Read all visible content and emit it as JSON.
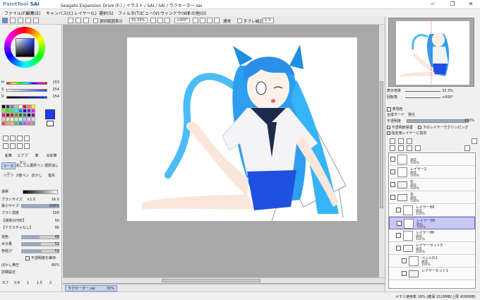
{
  "titlebar": {
    "app_name_prefix": "PaintTool",
    "app_name": "SAI",
    "title": "Seagate Expansion Drive (F:) / イラスト / SAI / SAI / ラクセーター.sai",
    "minimize": "─",
    "maximize": "❐",
    "close": "✕"
  },
  "menu": [
    "ファイル(F)",
    "編集(E)",
    "キャンバス(C)",
    "レイヤー(L)",
    "選択(S)",
    "フィルタ(T)",
    "ビュー(V)",
    "ウィンドウ(W)",
    "その他(O)"
  ],
  "toolbar": {
    "selection_label": "選択範囲表示",
    "zoom": "33.33%",
    "rotation": "+000°",
    "blend_label": "通常",
    "stabilizer_label": "手ブレ補正",
    "stabilizer_value": "S-3"
  },
  "color": {
    "current": "#1a3cff",
    "secondary": "#ffffff",
    "h_label": "H",
    "h_value": "153",
    "s_label": "S",
    "s_value": "254",
    "v_label": "V",
    "v_value": "254",
    "swatches": [
      "#000000",
      "#404040",
      "#808080",
      "#c0c0c0",
      "#ffffff",
      "#ff0000",
      "#ff8000",
      "#ffff00",
      "#80ff00",
      "#00ff00",
      "#00ff80",
      "#00ffff",
      "#0080ff",
      "#0000ff",
      "#8000ff",
      "#ff00ff",
      "#ff0080",
      "#800000",
      "#804000",
      "#808000",
      "#008000",
      "#008080",
      "#000080",
      "#800080",
      "#ffc0c0",
      "#ffe0c0",
      "#ffffc0",
      "#c0ffc0",
      "#c0ffff",
      "#c0c0ff",
      "#ffc0ff",
      "#e0e0e0",
      "#ff4040",
      "#ffa060",
      "#e0c080",
      "#60c060",
      "#4080ff",
      "#a060ff",
      "#ff60a0",
      "#a0a0a0"
    ]
  },
  "tools": {
    "row1": [
      "鉛筆",
      "エアブラシ",
      "筆",
      "水彩筆"
    ],
    "row2": [
      "マーカー",
      "消しゴム",
      "選択ペン",
      "選択消し"
    ],
    "row3": [
      "バケツ",
      "2値ペン",
      "ぼかし",
      "指先"
    ]
  },
  "brush": {
    "blend_label": "通常",
    "size_label": "ブラシサイズ",
    "size_mult": "×1.0",
    "size_value": "16.0",
    "min_size_label": "最小サイズ",
    "min_size_value": "100%",
    "density_label": "ブラシ濃度",
    "density_value": "100",
    "edge_label": "【通常の円形】",
    "edge_value": "50",
    "texture_label": "【テクスチャなし】",
    "texture_value": "95",
    "blend_amount_label": "混色",
    "blend_amount_value": "48",
    "water_label": "水分量",
    "water_value": "52",
    "persist_label": "色延び",
    "persist_value": "53",
    "keep_opacity_label": "不透明度を維持",
    "blur_label": "ぼかし筆圧",
    "blur_value": "80%",
    "detail_label": "詳細設定",
    "presets": [
      "0.7",
      "0.8",
      "1",
      "1.5",
      "2"
    ]
  },
  "navigator": {
    "zoom_label": "表示倍率",
    "zoom_value": "33.3%",
    "angle_label": "回転角",
    "angle_value": "+000°"
  },
  "layer_panel": {
    "effect_label": "表現色",
    "effect_value": "発光",
    "mode_label": "合成モード",
    "opacity_label": "不透明度",
    "opacity_value": "100%",
    "protect_label": "不透明度保護",
    "clip_label": "下のレイヤーでクリッピング",
    "ref_label": "指定用レイヤーに指定"
  },
  "layers": [
    {
      "name": "",
      "mode": "通常",
      "opacity": "100%",
      "type": "layer"
    },
    {
      "name": "レイヤー2",
      "mode": "通常",
      "opacity": "100%",
      "type": "layer"
    },
    {
      "name": "右",
      "mode": "通常",
      "opacity": "100%",
      "type": "folder"
    },
    {
      "name": "左",
      "mode": "通常",
      "opacity": "100%",
      "type": "folder"
    },
    {
      "name": "レイヤー89",
      "mode": "通常",
      "opacity": "100%",
      "type": "layer"
    },
    {
      "name": "レイヤー88",
      "mode": "発光",
      "opacity": "100%",
      "type": "layer",
      "selected": true
    },
    {
      "name": "レイヤー88",
      "mode": "通常",
      "opacity": "100%",
      "type": "layer"
    },
    {
      "name": "レイヤーセット5",
      "mode": "通常",
      "opacity": "100%",
      "type": "folder"
    },
    {
      "name": "ペン入れ1",
      "mode": "通常",
      "opacity": "100%",
      "type": "layer"
    },
    {
      "name": "レイヤーセット1",
      "mode": "",
      "opacity": "",
      "type": "folder"
    }
  ],
  "document": {
    "tab_name": "ラクセーター.sai",
    "tab_zoom": "33%"
  },
  "status": {
    "memory": "メモリ使用率 18% (確保 1518MB/上限 4095MB)"
  }
}
